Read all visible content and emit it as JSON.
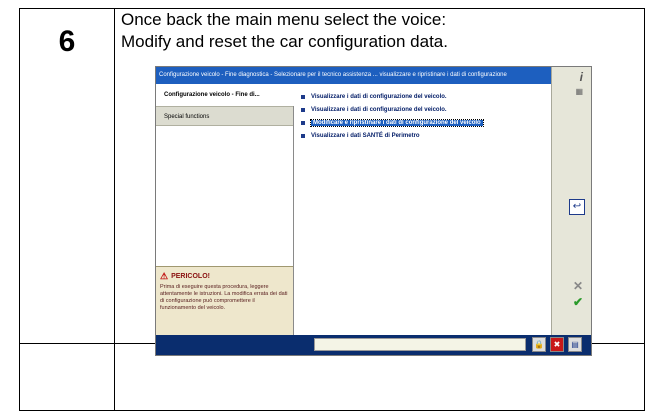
{
  "step": {
    "number": "6"
  },
  "instructions": {
    "line1": "Once back the main menu select the voice:",
    "line2": "Modify and reset the car configuration data."
  },
  "screenshot": {
    "title_bar": "Configurazione veicolo - Fine diagnostica - Selezionare per il tecnico assistenza ... visualizzare e ripristinare i dati di configurazione",
    "nav": {
      "item1": "Configurazione veicolo - Fine di...",
      "item2": "Special functions"
    },
    "options": [
      "Visualizzare i dati di configurazione del veicolo.",
      "Visualizzare i dati di configurazione del veicolo.",
      "Modificare e ripristinare i dati di configurazione del veicolo",
      "Visualizzare i dati SANTÉ di Perimetro"
    ],
    "selected_option": 2,
    "warning": {
      "title": "PERICOLO!",
      "body": "Prima di eseguire questa procedura, leggere attentamente le istruzioni. La modifica errata dei dati di configurazione può compromettere il funzionamento del veicolo."
    }
  },
  "colors": {
    "title_bar": "#1d5fbf",
    "bottom_bar": "#0a2d6e",
    "warning_bg": "#eee7cc"
  }
}
